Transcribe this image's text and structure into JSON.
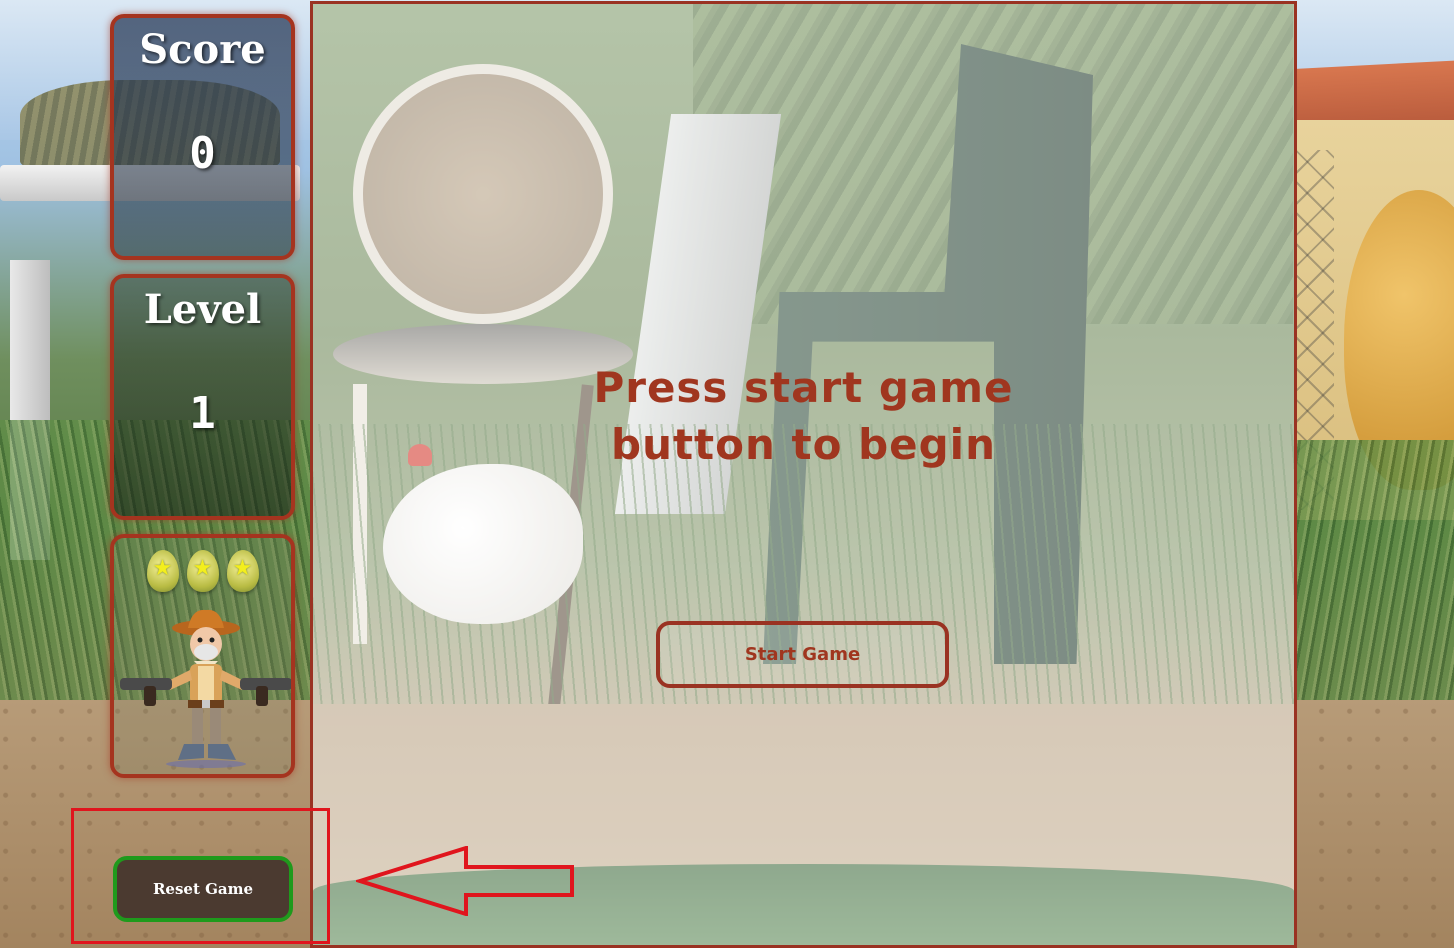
{
  "score_panel": {
    "title": "Score",
    "value": "0"
  },
  "level_panel": {
    "title": "Level",
    "value": "1"
  },
  "lives_panel": {
    "lives_count": 3
  },
  "main": {
    "message_line1": "Press start game",
    "message_line2": "button to begin",
    "start_button_label": "Start Game"
  },
  "reset_button_label": "Reset Game",
  "colors": {
    "accent": "#a5341f",
    "reset_border": "#1f9a1c",
    "annotation": "#e0151d"
  }
}
